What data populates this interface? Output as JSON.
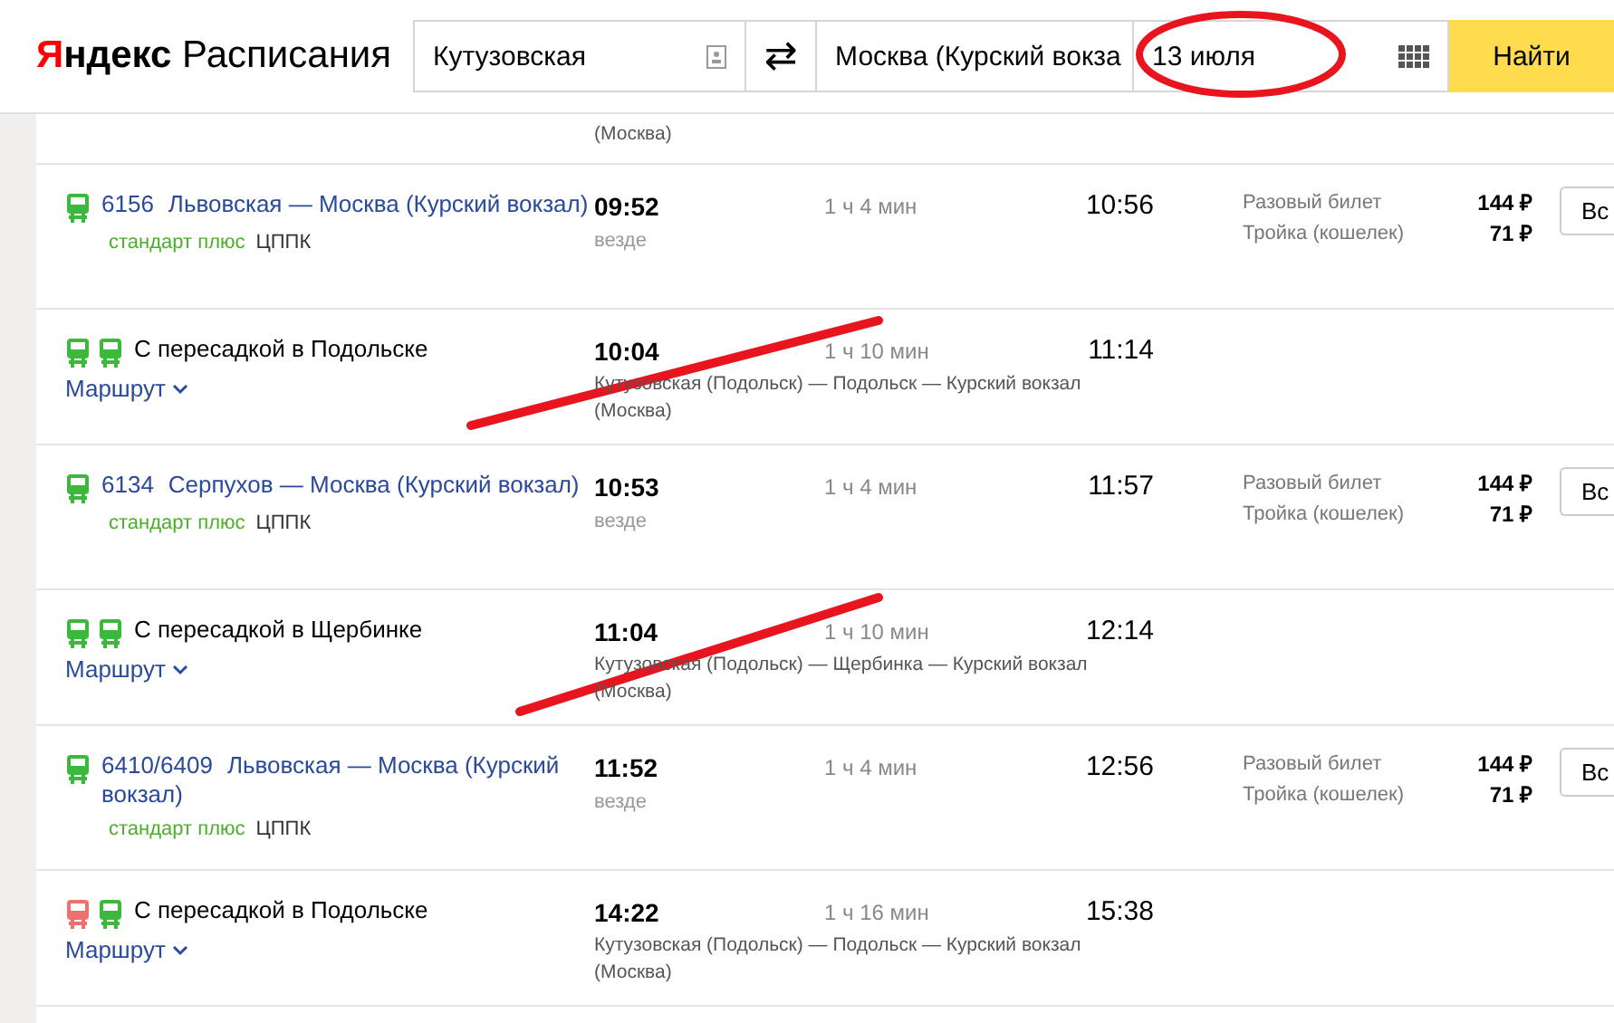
{
  "header": {
    "logo": {
      "brand": "Яндекс",
      "service": "Расписания"
    },
    "from": "Кутузовская",
    "swap": "⇄",
    "to": "Москва (Курский вокза",
    "date": "13 июля",
    "search_button": "Найти"
  },
  "partial_row": {
    "line": "(Москва)"
  },
  "rows": [
    {
      "kind": "train",
      "icons": [
        {
          "color": "#3cb93c"
        }
      ],
      "number": "6156",
      "route": "Львовская — Москва (Курский вокзал)",
      "category": "стандарт плюс",
      "carrier": "ЦППК",
      "departure": "09:52",
      "stops": "везде",
      "duration": "1 ч 4 мин",
      "arrival": "10:56",
      "fares": [
        {
          "label": "Разовый билет",
          "price": "144 ₽"
        },
        {
          "label": "Тройка (кошелек)",
          "price": "71 ₽"
        }
      ],
      "button": "Вс"
    },
    {
      "kind": "transfer",
      "icons": [
        {
          "color": "#3cb93c"
        },
        {
          "color": "#3cb93c"
        }
      ],
      "title": "С пересадкой в Подольске",
      "link": "Маршрут",
      "departure": "10:04",
      "path": "Кутузовская (Подольск) — Подольск — Курский вокзал (Москва)",
      "duration": "1 ч 10 мин",
      "arrival": "11:14"
    },
    {
      "kind": "train",
      "icons": [
        {
          "color": "#3cb93c"
        }
      ],
      "number": "6134",
      "route": "Серпухов — Москва (Курский вокзал)",
      "category": "стандарт плюс",
      "carrier": "ЦППК",
      "departure": "10:53",
      "stops": "везде",
      "duration": "1 ч 4 мин",
      "arrival": "11:57",
      "fares": [
        {
          "label": "Разовый билет",
          "price": "144 ₽"
        },
        {
          "label": "Тройка (кошелек)",
          "price": "71 ₽"
        }
      ],
      "button": "Вс"
    },
    {
      "kind": "transfer",
      "icons": [
        {
          "color": "#3cb93c"
        },
        {
          "color": "#3cb93c"
        }
      ],
      "title": "С пересадкой в Щербинке",
      "link": "Маршрут",
      "departure": "11:04",
      "path": "Кутузовская (Подольск) — Щербинка — Курский вокзал (Москва)",
      "duration": "1 ч 10 мин",
      "arrival": "12:14"
    },
    {
      "kind": "train",
      "icons": [
        {
          "color": "#3cb93c"
        }
      ],
      "number": "6410/6409",
      "route": "Львовская — Москва (Курский вокзал)",
      "category": "стандарт плюс",
      "carrier": "ЦППК",
      "departure": "11:52",
      "stops": "везде",
      "duration": "1 ч 4 мин",
      "arrival": "12:56",
      "fares": [
        {
          "label": "Разовый билет",
          "price": "144 ₽"
        },
        {
          "label": "Тройка (кошелек)",
          "price": "71 ₽"
        }
      ],
      "button": "Вс"
    },
    {
      "kind": "transfer",
      "icons": [
        {
          "color": "#f07070"
        },
        {
          "color": "#3cb93c"
        }
      ],
      "title": "С пересадкой в Подольске",
      "link": "Маршрут",
      "departure": "14:22",
      "path": "Кутузовская (Подольск) — Подольск — Курский вокзал (Москва)",
      "duration": "1 ч 16 мин",
      "arrival": "15:38"
    }
  ]
}
